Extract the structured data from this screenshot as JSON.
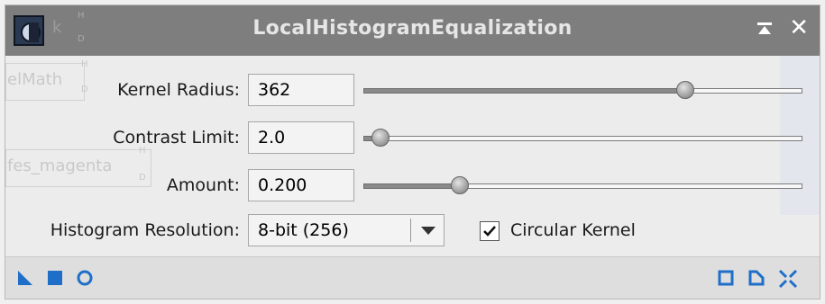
{
  "window": {
    "title": "LocalHistogramEqualization"
  },
  "background_ghosts": {
    "item1": "k",
    "item2": "elMath",
    "item3": "fes_magenta",
    "marker_h": "H",
    "marker_d": "D"
  },
  "params": {
    "kernel_radius": {
      "label": "Kernel Radius:",
      "value": "362",
      "slider_fraction": 0.733
    },
    "contrast_limit": {
      "label": "Contrast Limit:",
      "value": "2.0",
      "slider_fraction": 0.04
    },
    "amount": {
      "label": "Amount:",
      "value": "0.200",
      "slider_fraction": 0.22
    }
  },
  "histogram": {
    "label": "Histogram Resolution:",
    "selected": "8-bit (256)"
  },
  "circular_kernel": {
    "label": "Circular Kernel",
    "checked": true
  },
  "colors": {
    "accent": "#1f6fc9",
    "titlebar": "#7e7e7e"
  },
  "icons": {
    "new_instance": "triangle-icon",
    "apply_global": "square-filled-icon",
    "real_time_preview": "circle-icon",
    "browse_docs": "square-outline-icon",
    "reset": "document-corner-icon",
    "collapse": "collapse-arrows-icon"
  }
}
